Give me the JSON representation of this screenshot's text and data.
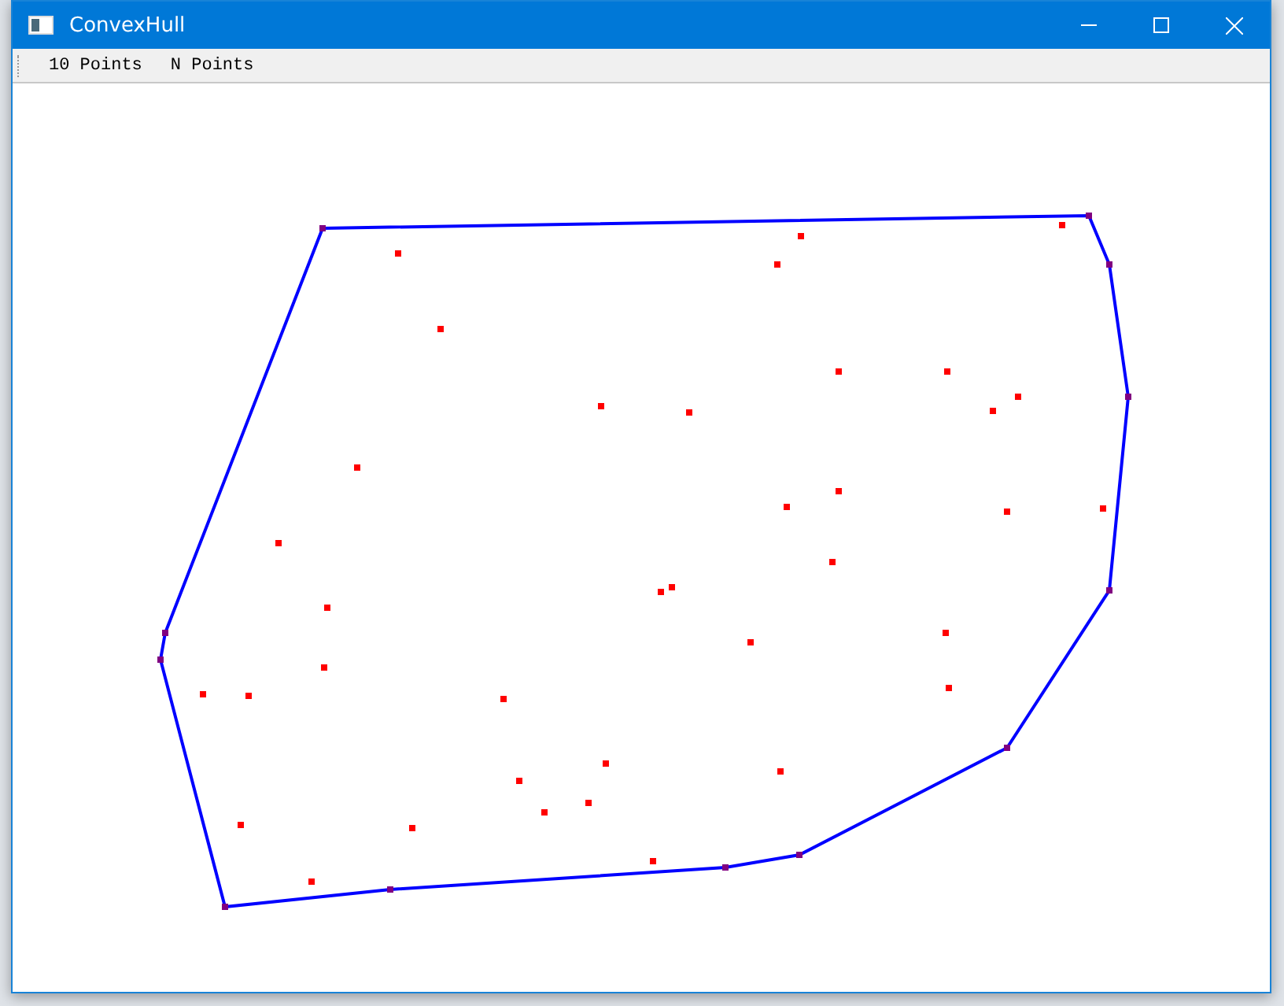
{
  "window": {
    "title": "ConvexHull"
  },
  "toolbar": {
    "buttons": [
      "10 Points",
      "N Points"
    ]
  }
}
